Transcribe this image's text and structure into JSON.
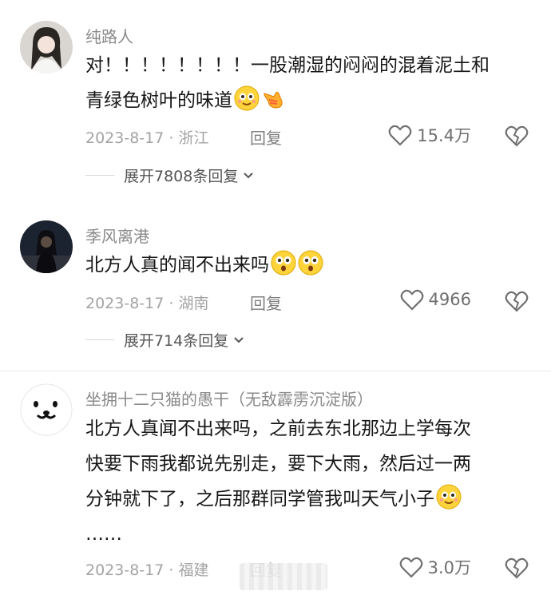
{
  "comments": [
    {
      "username": "纯路人",
      "text_lines": [
        "对！！！！！！！！一股潮湿的闷闷的混着泥土和",
        "青绿色树叶的味道"
      ],
      "emoji": [
        "smile-emoji",
        "pointing-hand-emoji"
      ],
      "meta": "2023-8-17 · 浙江",
      "reply_label": "回复",
      "likes": "15.4万",
      "expand_label": "展开7808条回复"
    },
    {
      "username": "季风离港",
      "text_lines": [
        "北方人真的闻不出来吗"
      ],
      "emoji": [
        "surprised-emoji",
        "surprised-emoji"
      ],
      "meta": "2023-8-17 · 湖南",
      "reply_label": "回复",
      "likes": "4966",
      "expand_label": "展开714条回复"
    },
    {
      "username": "坐拥十二只猫的愚干（无敌霹雳沉淀版）",
      "text_lines": [
        "北方人真闻不出来吗，之前去东北那边上学每次",
        "快要下雨我都说先别走，要下大雨，然后过一两",
        "分钟就下了，之后那群同学管我叫天气小子",
        "……"
      ],
      "emoji": [
        "smile-emoji"
      ],
      "meta": "2023-8-17 · 福建",
      "reply_label": "回复",
      "likes": "3.0万"
    }
  ],
  "colors": {
    "username": "#8a8a8a",
    "meta": "#a3a3a3",
    "text": "#161616",
    "icon": "#6f6f6f"
  }
}
